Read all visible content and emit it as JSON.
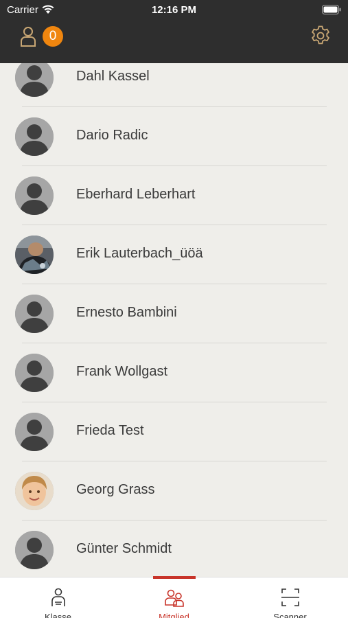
{
  "status_bar": {
    "carrier": "Carrier",
    "time": "12:16 PM"
  },
  "header": {
    "badge_count": "0",
    "accent_color": "#f0860f"
  },
  "members": [
    {
      "name": "Dahl Kassel",
      "avatar": "placeholder"
    },
    {
      "name": "Dario Radic",
      "avatar": "placeholder"
    },
    {
      "name": "Eberhard Leberhart",
      "avatar": "placeholder"
    },
    {
      "name": "Erik Lauterbach_üöä",
      "avatar": "photo"
    },
    {
      "name": "Ernesto Bambini",
      "avatar": "placeholder"
    },
    {
      "name": "Frank Wollgast",
      "avatar": "placeholder"
    },
    {
      "name": "Frieda Test",
      "avatar": "placeholder"
    },
    {
      "name": "Georg Grass",
      "avatar": "photo-child"
    },
    {
      "name": "Günter Schmidt",
      "avatar": "placeholder"
    }
  ],
  "tabs": [
    {
      "label": "Klasse",
      "icon": "class-icon",
      "active": false
    },
    {
      "label": "Mitglied",
      "icon": "members-icon",
      "active": true
    },
    {
      "label": "Scanner",
      "icon": "scanner-icon",
      "active": false
    }
  ],
  "colors": {
    "tab_active": "#c8342a",
    "header_bg": "#2e2e2e",
    "list_bg": "#efeeea"
  }
}
